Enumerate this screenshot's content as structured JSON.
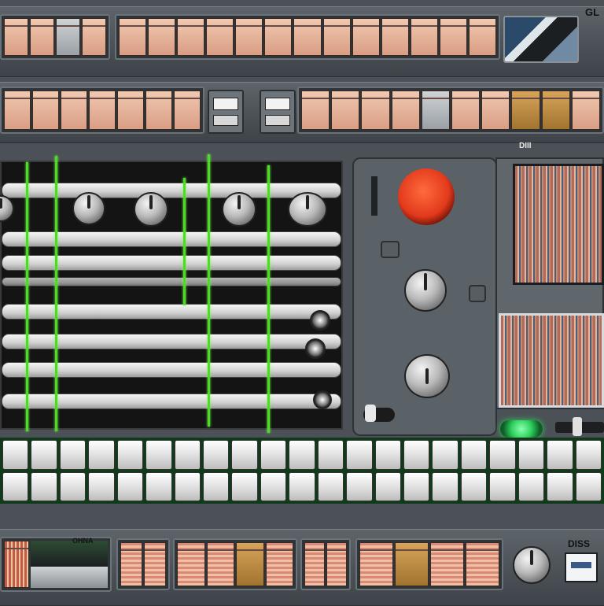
{
  "app": {
    "top_label": "GL",
    "mid_label": "DIII",
    "bottom_label": "DISS",
    "bottom_left_label": "OHNA"
  },
  "icons": {
    "record_button": "record-icon",
    "status_led": "led-icon",
    "knobs": [
      "rotary-knob-icon"
    ]
  },
  "colors": {
    "record": "#e23a1c",
    "led": "#2ecf5c",
    "playhead": "#4bdc23",
    "chassis": "#4b5156"
  }
}
